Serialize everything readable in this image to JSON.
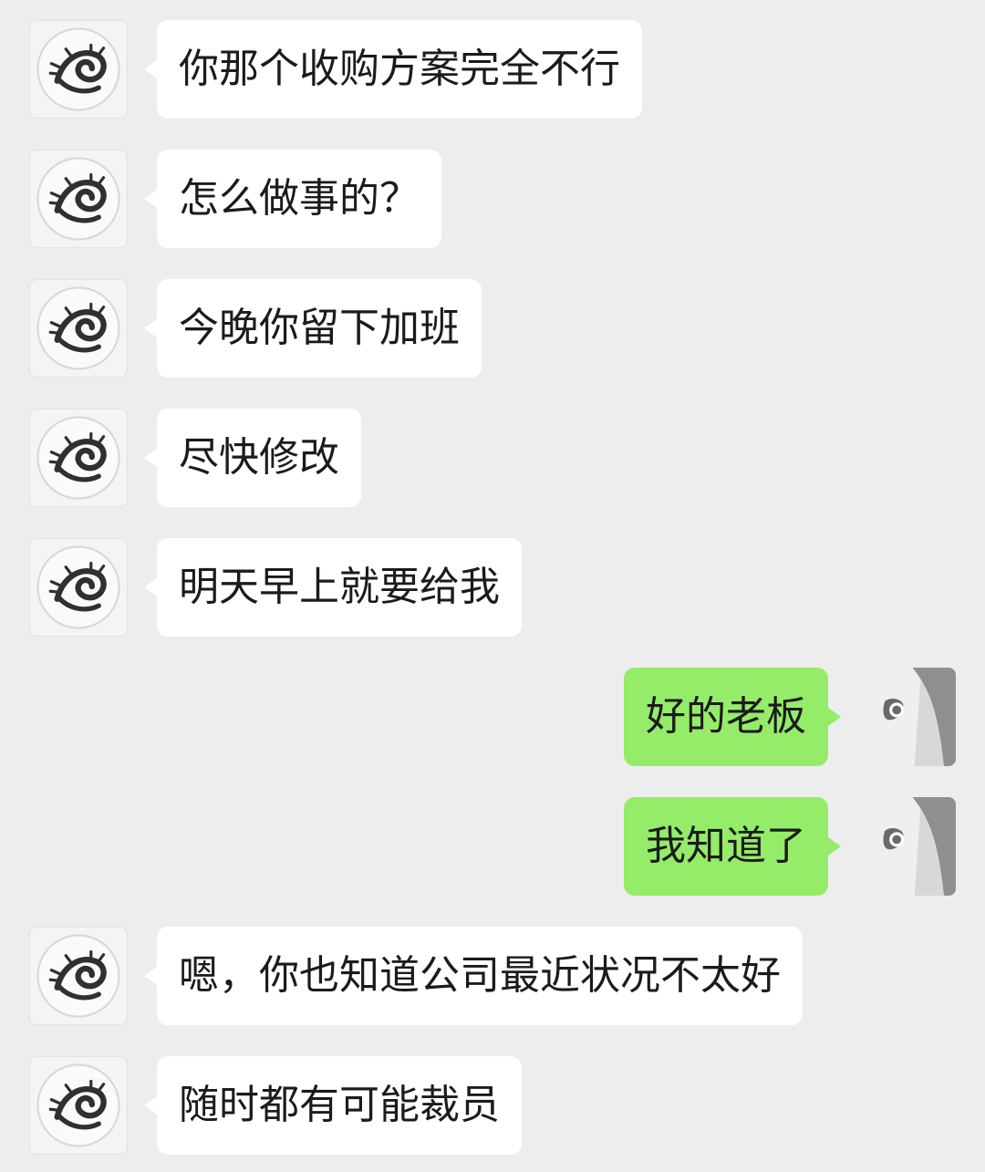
{
  "chat": {
    "messages": [
      {
        "side": "in",
        "text": "你那个收购方案完全不行",
        "avatar": "dragon-avatar"
      },
      {
        "side": "in",
        "text": "怎么做事的？",
        "avatar": "dragon-avatar"
      },
      {
        "side": "in",
        "text": "今晚你留下加班",
        "avatar": "dragon-avatar"
      },
      {
        "side": "in",
        "text": "尽快修改",
        "avatar": "dragon-avatar"
      },
      {
        "side": "in",
        "text": "明天早上就要给我",
        "avatar": "dragon-avatar"
      },
      {
        "side": "out",
        "text": "好的老板",
        "avatar": "person-avatar"
      },
      {
        "side": "out",
        "text": "我知道了",
        "avatar": "person-avatar"
      },
      {
        "side": "in",
        "text": "嗯，你也知道公司最近状况不太好",
        "avatar": "dragon-avatar"
      },
      {
        "side": "in",
        "text": "随时都有可能裁员",
        "avatar": "dragon-avatar"
      }
    ]
  },
  "colors": {
    "background": "#ededed",
    "incoming_bubble": "#ffffff",
    "outgoing_bubble": "#95ec69",
    "text": "#1b1b1b"
  }
}
